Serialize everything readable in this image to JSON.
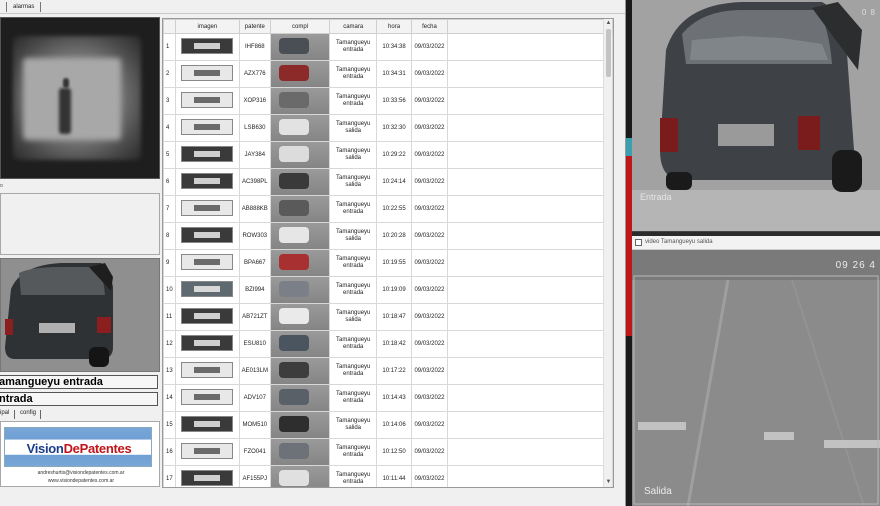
{
  "topbar": {
    "tab_alarmas": "alarmas"
  },
  "left_panel": {
    "small_char": "o",
    "camera_label": "amangueyu entrada",
    "tipo_label": "ntrada",
    "subtabs": {
      "tab1": "ipal",
      "tab2": "config"
    },
    "brand": {
      "part1": "Vision",
      "part2": "DePatentes",
      "email": "andreshurtis@visiondepatentes.com.ar",
      "web": "www.visiondepatentes.com.ar"
    }
  },
  "table": {
    "headers": {
      "imagen": "imagen",
      "patente": "patente",
      "compl": "compl",
      "camara": "camara",
      "hora": "hora",
      "fecha": "fecha"
    },
    "rows": [
      {
        "n": "1",
        "patente": "IHF868",
        "camara": "Tamangueyu entrada",
        "hora": "10:34:38",
        "fecha": "09/03/2022",
        "plate": "dark",
        "car": "#4a4f55"
      },
      {
        "n": "2",
        "patente": "AZX776",
        "camara": "Tamangueyu entrada",
        "hora": "10:34:31",
        "fecha": "09/03/2022",
        "plate": "light",
        "car": "#8c2a2a"
      },
      {
        "n": "3",
        "patente": "XOP316",
        "camara": "Tamangueyu entrada",
        "hora": "10:33:56",
        "fecha": "09/03/2022",
        "plate": "light",
        "car": "#6a6a6a"
      },
      {
        "n": "4",
        "patente": "LSB630",
        "camara": "Tamangueyu salida",
        "hora": "10:32:30",
        "fecha": "09/03/2022",
        "plate": "light",
        "car": "#e2e2e2"
      },
      {
        "n": "5",
        "patente": "JAY384",
        "camara": "Tamangueyu salida",
        "hora": "10:29:22",
        "fecha": "09/03/2022",
        "plate": "dark",
        "car": "#dcdcdc"
      },
      {
        "n": "6",
        "patente": "AC398PL",
        "camara": "Tamangueyu salida",
        "hora": "10:24:14",
        "fecha": "09/03/2022",
        "plate": "dark",
        "car": "#3a3a3a"
      },
      {
        "n": "7",
        "patente": "AB888KB",
        "camara": "Tamangueyu entrada",
        "hora": "10:22:55",
        "fecha": "09/03/2022",
        "plate": "light",
        "car": "#5a5a5a"
      },
      {
        "n": "8",
        "patente": "ROW303",
        "camara": "Tamangueyu salida",
        "hora": "10:20:28",
        "fecha": "09/03/2022",
        "plate": "dark",
        "car": "#e6e6e6"
      },
      {
        "n": "9",
        "patente": "BPA667",
        "camara": "Tamangueyu entrada",
        "hora": "10:19:55",
        "fecha": "09/03/2022",
        "plate": "light",
        "car": "#a83030"
      },
      {
        "n": "10",
        "patente": "BZI994",
        "camara": "Tamangueyu entrada",
        "hora": "10:19:09",
        "fecha": "09/03/2022",
        "plate": "mid",
        "car": "#7b8088"
      },
      {
        "n": "11",
        "patente": "AB721ZT",
        "camara": "Tamangueyu salida",
        "hora": "10:18:47",
        "fecha": "09/03/2022",
        "plate": "dark",
        "car": "#eaeaea"
      },
      {
        "n": "12",
        "patente": "ESU810",
        "camara": "Tamangueyu entrada",
        "hora": "10:18:42",
        "fecha": "09/03/2022",
        "plate": "dark",
        "car": "#4b5560"
      },
      {
        "n": "13",
        "patente": "AE013LM",
        "camara": "Tamangueyu entrada",
        "hora": "10:17:22",
        "fecha": "09/03/2022",
        "plate": "light",
        "car": "#3d3d3d"
      },
      {
        "n": "14",
        "patente": "ADV107",
        "camara": "Tamangueyu entrada",
        "hora": "10:14:43",
        "fecha": "09/03/2022",
        "plate": "light",
        "car": "#5a6068"
      },
      {
        "n": "15",
        "patente": "MOM510",
        "camara": "Tamangueyu salida",
        "hora": "10:14:06",
        "fecha": "09/03/2022",
        "plate": "dark",
        "car": "#2e2e2e"
      },
      {
        "n": "16",
        "patente": "FZO041",
        "camara": "Tamangueyu entrada",
        "hora": "10:12:50",
        "fecha": "09/03/2022",
        "plate": "light",
        "car": "#6d7278"
      },
      {
        "n": "17",
        "patente": "AF155PJ",
        "camara": "Tamangueyu entrada",
        "hora": "10:11:44",
        "fecha": "09/03/2022",
        "plate": "dark",
        "car": "#e0e0e0"
      }
    ]
  },
  "cameras": {
    "entrada": {
      "label": "Entrada",
      "timestamp": "0 8"
    },
    "salida": {
      "window_title": "video Tamangueyu salida",
      "label": "Salida",
      "timestamp": "09 26 4"
    }
  },
  "colors": {
    "brand_blue": "#1a3d8c",
    "brand_red": "#c0151b",
    "indicator_cyan": "#3a9fb0",
    "indicator_red": "#c01818"
  }
}
